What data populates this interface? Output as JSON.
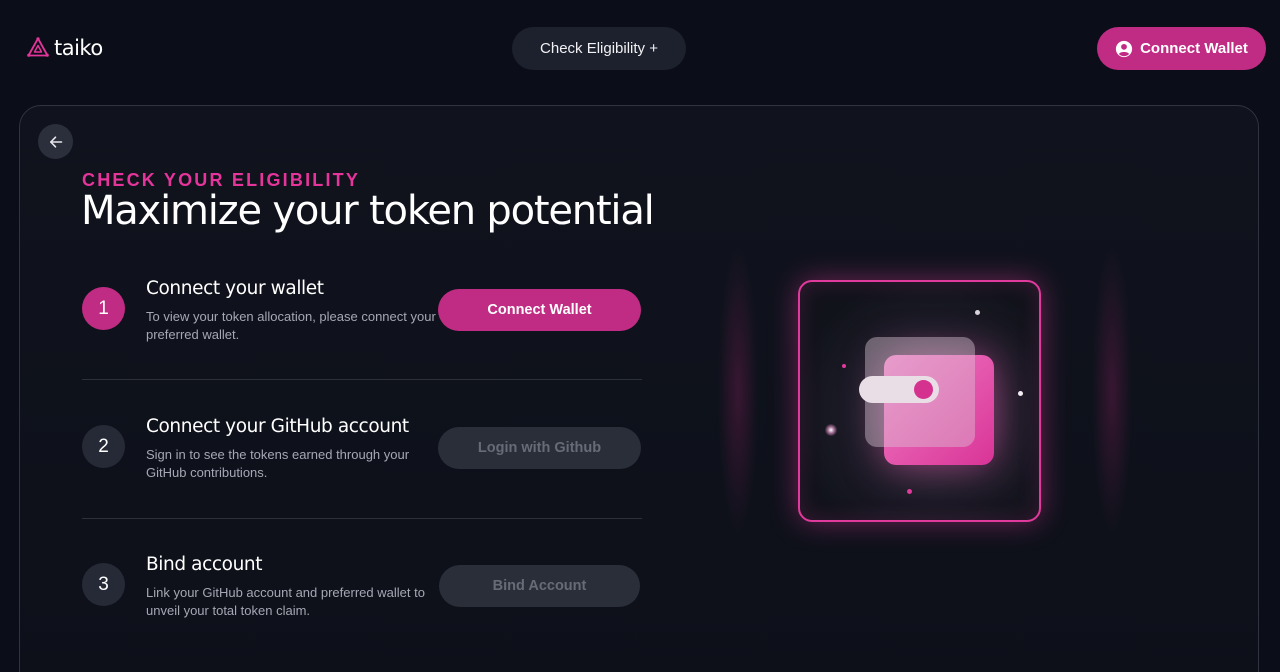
{
  "header": {
    "logo_text": "taiko",
    "check_eligibility": "Check Eligibility +",
    "connect_wallet": "Connect Wallet"
  },
  "hero": {
    "eyebrow": "CHECK YOUR ELIGIBILITY",
    "title": "Maximize your token potential"
  },
  "steps": [
    {
      "number": "1",
      "title": "Connect your wallet",
      "description": "To view your token allocation, please connect your preferred wallet.",
      "button": "Connect Wallet"
    },
    {
      "number": "2",
      "title": "Connect your GitHub account",
      "description": "Sign in to see the tokens earned through your GitHub contributions.",
      "button": "Login with Github"
    },
    {
      "number": "3",
      "title": "Bind account",
      "description": "Link your GitHub account and preferred wallet to unveil your total token claim.",
      "button": "Bind Account"
    }
  ],
  "colors": {
    "accent": "#c02c83",
    "eyebrow": "#e5349a",
    "background": "#0b0e19"
  },
  "icons": [
    "taiko-logo-icon",
    "user-circle-icon",
    "arrow-left-icon",
    "wallet-illustration"
  ]
}
